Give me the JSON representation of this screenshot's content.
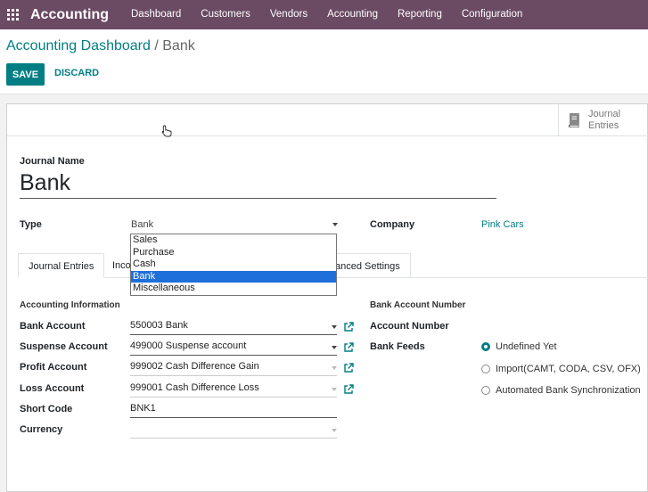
{
  "topbar": {
    "app_name": "Accounting",
    "menu": [
      "Dashboard",
      "Customers",
      "Vendors",
      "Accounting",
      "Reporting",
      "Configuration"
    ]
  },
  "control_panel": {
    "breadcrumb_parent": "Accounting Dashboard",
    "breadcrumb_sep": "/",
    "breadcrumb_current": "Bank",
    "save_label": "SAVE",
    "discard_label": "DISCARD"
  },
  "button_box": {
    "journal_entries_line1": "Journal",
    "journal_entries_line2": "Entries"
  },
  "form": {
    "journal_name_label": "Journal Name",
    "journal_name_value": "Bank",
    "type_label": "Type",
    "type_value": "Bank",
    "company_label": "Company",
    "company_value": "Pink Cars"
  },
  "type_dropdown": {
    "options": [
      "Sales",
      "Purchase",
      "Cash",
      "Bank",
      "Miscellaneous"
    ],
    "selected_index": 3
  },
  "tabs": [
    "Journal Entries",
    "Inco",
    "anced Settings"
  ],
  "accounting_info": {
    "title": "Accounting Information",
    "rows": [
      {
        "label": "Bank Account",
        "value": "550003 Bank"
      },
      {
        "label": "Suspense Account",
        "value": "499000 Suspense account"
      },
      {
        "label": "Profit Account",
        "value": "999002 Cash Difference Gain"
      },
      {
        "label": "Loss Account",
        "value": "999001 Cash Difference Loss"
      },
      {
        "label": "Short Code",
        "value": "BNK1"
      },
      {
        "label": "Currency",
        "value": ""
      }
    ]
  },
  "bank_account": {
    "title": "Bank Account Number",
    "account_number_label": "Account Number",
    "bank_feeds_label": "Bank Feeds",
    "feed_options": [
      "Undefined Yet",
      "Import(CAMT, CODA, CSV, OFX)",
      "Automated Bank Synchronization"
    ],
    "feed_selected_index": 0
  },
  "colors": {
    "topbar": "#6b4a64",
    "accent": "#017e84",
    "dropdown_selected": "#1e6fd9"
  },
  "icons": [
    "apps-grid-icon",
    "book-icon",
    "external-link-icon",
    "pointer-cursor-icon"
  ]
}
